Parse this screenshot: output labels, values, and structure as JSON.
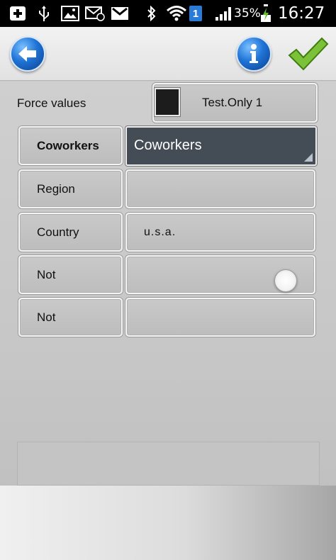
{
  "status_bar": {
    "battery_percent": "35%",
    "time": "16:27",
    "sim_badge": "1",
    "icons": [
      "add-box-icon",
      "usb-icon",
      "image-icon",
      "sms-icon",
      "gmail-icon",
      "bluetooth-icon",
      "wifi-icon",
      "sim-badge-icon",
      "signal-icon",
      "battery-charging-icon"
    ]
  },
  "action_bar": {
    "back_icon": "back-arrow-icon",
    "info_icon": "info-icon",
    "confirm_icon": "checkmark-icon",
    "accent": "#1f74d6",
    "confirm_color": "#6fb52c"
  },
  "form": {
    "force_values_label": "Force values",
    "force_checkbox_label": "Test.Only 1",
    "rows": [
      {
        "label": "Coworkers",
        "value": "Coworkers"
      },
      {
        "label": "Region",
        "value": ""
      },
      {
        "label": "Country",
        "value": "u.s.a."
      },
      {
        "label": "Not",
        "value": ""
      },
      {
        "label": "Not",
        "value": ""
      }
    ]
  }
}
